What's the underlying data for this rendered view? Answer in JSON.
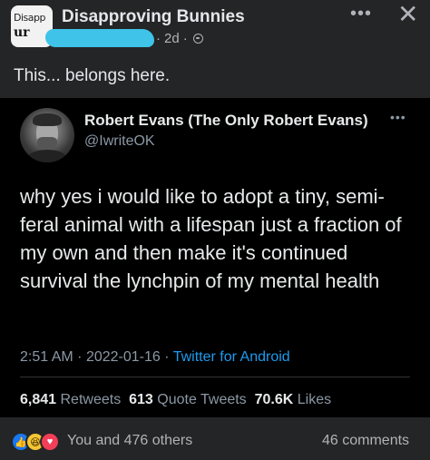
{
  "header": {
    "group_avatar_line1": "Disapp",
    "group_avatar_line2": "ur",
    "group_name": "Disapproving Bunnies",
    "time": "2d",
    "privacy_icon": "globe-icon",
    "more_icon": "more-icon",
    "close_icon": "close-icon",
    "redaction_color": "#3fc3e8"
  },
  "post": {
    "text": "This... belongs here."
  },
  "tweet": {
    "author_name": "Robert Evans (The Only Robert Evans)",
    "handle": "@IwriteOK",
    "body": "why yes i would like to adopt a tiny, semi-feral animal with a lifespan just a fraction of my own and then make it's continued survival the lynchpin of my mental health",
    "time": "2:51 AM",
    "date": "2022-01-16",
    "source": "Twitter for Android",
    "retweets_count": "6,841",
    "retweets_label": "Retweets",
    "quote_tweets_count": "613",
    "quote_tweets_label": "Quote Tweets",
    "likes_count": "70.6K",
    "likes_label": "Likes",
    "link_color": "#1d9bf0"
  },
  "footer": {
    "reactions": [
      "like-icon",
      "haha-icon",
      "love-icon"
    ],
    "reaction_text": "You and 476 others",
    "comments": "46 comments"
  },
  "colors": {
    "background": "#242526",
    "tweet_background": "#000000",
    "primary_text": "#e4e6eb",
    "secondary_text": "#b0b3b8"
  }
}
